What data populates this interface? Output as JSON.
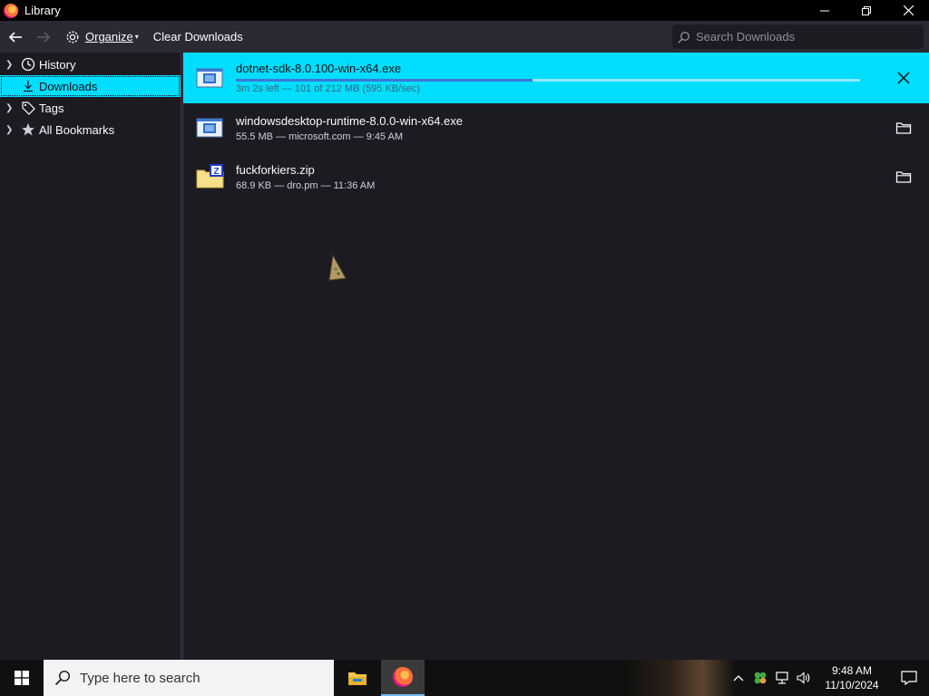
{
  "window": {
    "title": "Library"
  },
  "toolbar": {
    "organize_label": "Organize",
    "clear_label": "Clear Downloads",
    "search_placeholder": "Search Downloads"
  },
  "sidebar": {
    "items": [
      {
        "label": "History"
      },
      {
        "label": "Downloads"
      },
      {
        "label": "Tags"
      },
      {
        "label": "All Bookmarks"
      }
    ]
  },
  "downloads": [
    {
      "name": "dotnet-sdk-8.0.100-win-x64.exe",
      "status": "3m 2s left — 101 of 212 MB (595 KB/sec)",
      "progress": 0.476,
      "state": "downloading"
    },
    {
      "name": "windowsdesktop-runtime-8.0.0-win-x64.exe",
      "status": "55.5 MB — microsoft.com — 9:45 AM",
      "state": "complete"
    },
    {
      "name": "fuckforkiers.zip",
      "status": "68.9 KB — dro.pm — 11:36 AM",
      "state": "complete"
    }
  ],
  "taskbar": {
    "search_placeholder": "Type here to search",
    "time": "9:48 AM",
    "date": "11/10/2024"
  },
  "colors": {
    "accent": "#00ddff",
    "progress": "#3b78d8",
    "background": "#1c1b22",
    "toolbar": "#2b2a33"
  }
}
